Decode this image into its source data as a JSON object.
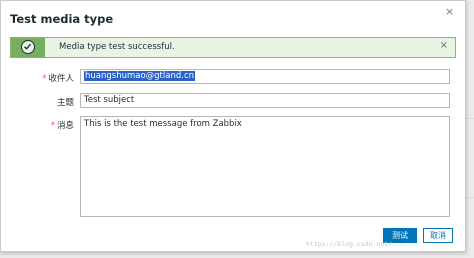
{
  "dialog": {
    "title": "Test media type",
    "close_glyph": "×"
  },
  "message": {
    "icon": "check-circle-icon",
    "text": "Media type test successful.",
    "close_glyph": "×",
    "colors": {
      "background": "#e8f4e4",
      "border": "#7fbc6b",
      "icon_box": "#74b060"
    }
  },
  "form": {
    "required_mark": "*",
    "recipient": {
      "label": "收件人",
      "value": "huangshumao@gtland.cn",
      "required": true
    },
    "subject": {
      "label": "主题",
      "value": "Test subject",
      "required": false
    },
    "message": {
      "label": "消息",
      "value": "This is the test message from Zabbix",
      "required": true
    }
  },
  "buttons": {
    "test": "测试",
    "cancel": "取消",
    "accent": "#0275b8"
  },
  "watermark": "https://blog.csdn.net/..."
}
